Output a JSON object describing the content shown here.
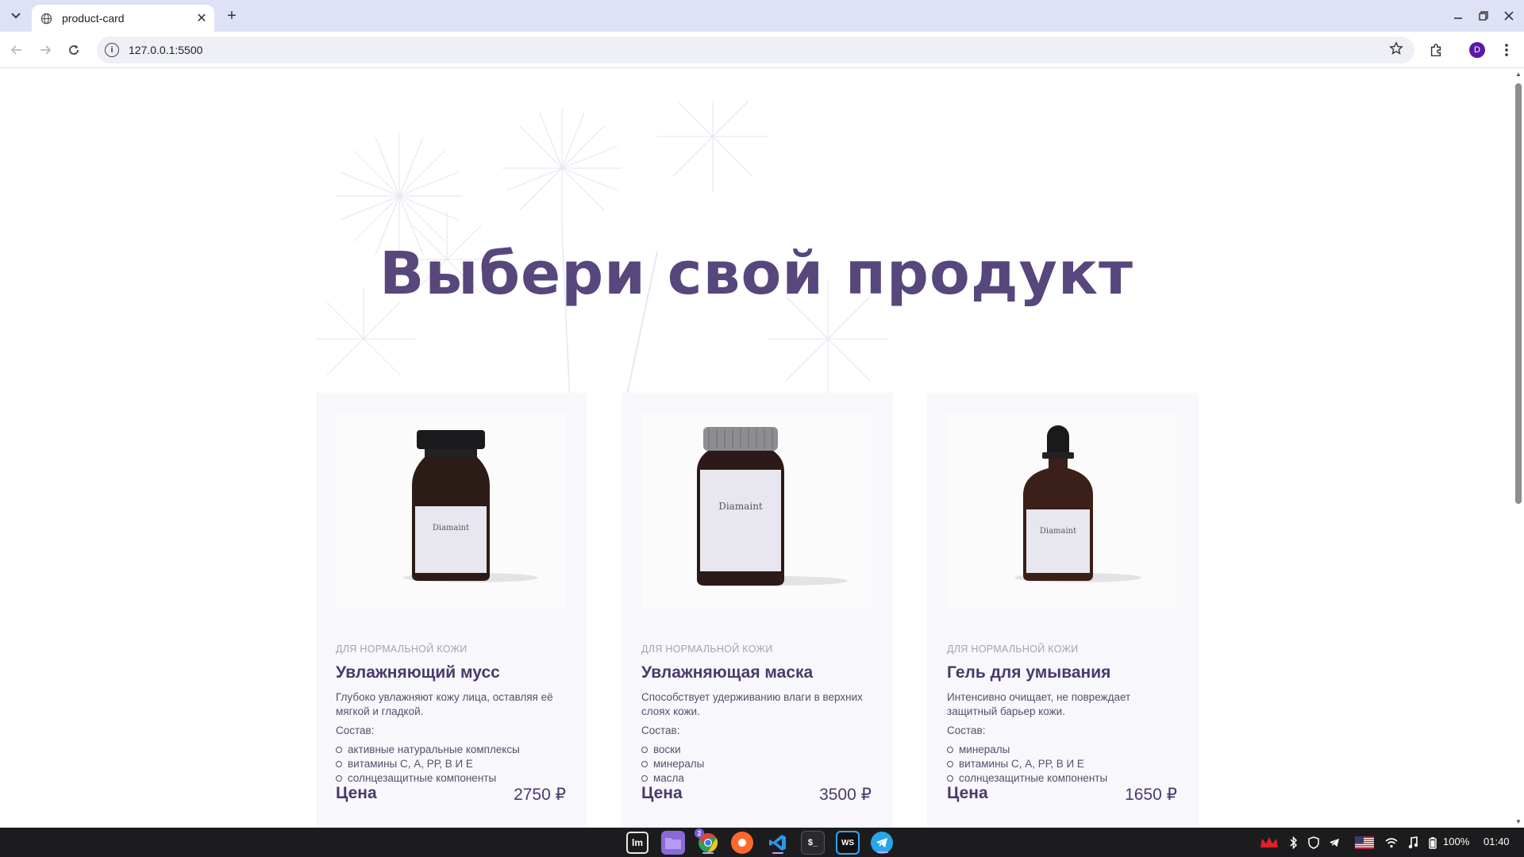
{
  "browser": {
    "tab_title": "product-card",
    "url": "127.0.0.1:5500",
    "new_tab_symbol": "+",
    "tab_close_symbol": "✕",
    "profile_initial": "D"
  },
  "page": {
    "heading": "Выбери свой продукт",
    "products": [
      {
        "tag": "ДЛЯ НОРМАЛЬНОЙ КОЖИ",
        "name": "Увлажняющий мусс",
        "description": "Глубоко увлажняют кожу лица, оставляя её мягкой и гладкой.",
        "composition_label": "Состав:",
        "ingredients": [
          "активные натуральные комплексы",
          "витамины С, А, РР, В И Е",
          "солнцезащитные компоненты"
        ],
        "price_label": "Цена",
        "price": "2750 ₽",
        "bottle_brand": "Diamaint",
        "bottle_type": "mousse-bottle"
      },
      {
        "tag": "ДЛЯ НОРМАЛЬНОЙ КОЖИ",
        "name": "Увлажняющая маска",
        "description": "Способствует удерживанию влаги в верхних слоях кожи.",
        "composition_label": "Состав:",
        "ingredients": [
          "воски",
          "минералы",
          "масла"
        ],
        "price_label": "Цена",
        "price": "3500 ₽",
        "bottle_brand": "Diamaint",
        "bottle_type": "mask-jar"
      },
      {
        "tag": "ДЛЯ НОРМАЛЬНОЙ КОЖИ",
        "name": "Гель для умывания",
        "description": "Интенсивно очищает, не повреждает защитный барьер кожи.",
        "composition_label": "Состав:",
        "ingredients": [
          "минералы",
          "витамины С, А, РР, В И Е",
          "солнцезащитные компоненты"
        ],
        "price_label": "Цена",
        "price": "1650 ₽",
        "bottle_brand": "Diamaint",
        "bottle_type": "gel-bottle"
      }
    ]
  },
  "taskbar": {
    "badge_count": "2",
    "battery": "100%",
    "clock": "01:40"
  },
  "colors": {
    "heading": "#57477c",
    "card_bg": "#f8f7fc",
    "text": "#55506a",
    "tag": "#a6a1b5",
    "tabbar": "#dfe2f6"
  }
}
